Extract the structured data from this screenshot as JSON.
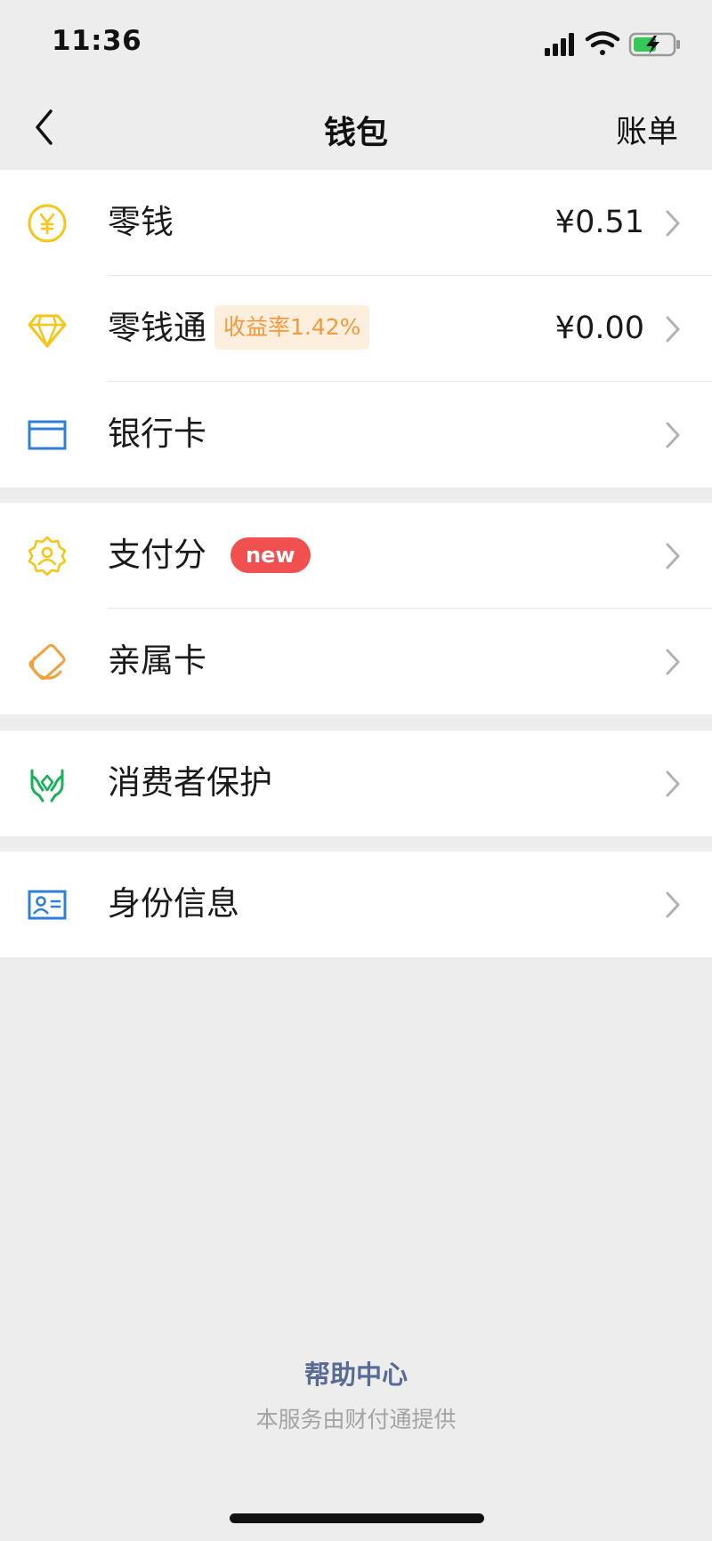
{
  "status_bar": {
    "time": "11:36",
    "battery_charging": true
  },
  "nav": {
    "back_icon": "chevron-left-icon",
    "title": "钱包",
    "bill_label": "账单"
  },
  "groups": [
    {
      "items": [
        {
          "icon": "yuan-coin-icon",
          "label": "零钱",
          "value": "¥0.51"
        },
        {
          "icon": "diamond-icon",
          "label": "零钱通",
          "badge": "收益率1.42%",
          "value": "¥0.00"
        },
        {
          "icon": "bank-card-icon",
          "label": "银行卡"
        }
      ]
    },
    {
      "items": [
        {
          "icon": "badge-user-icon",
          "label": "支付分",
          "badge": "new"
        },
        {
          "icon": "family-card-icon",
          "label": "亲属卡"
        }
      ]
    },
    {
      "items": [
        {
          "icon": "hands-protect-icon",
          "label": "消费者保护"
        }
      ]
    },
    {
      "items": [
        {
          "icon": "id-card-icon",
          "label": "身份信息"
        }
      ]
    }
  ],
  "footer": {
    "help_link": "帮助中心",
    "provider_text": "本服务由财付通提供"
  },
  "colors": {
    "background": "#ededed",
    "link_blue": "#576b95",
    "badge_orange_bg": "#fdeedd",
    "badge_orange_text": "#f29a3b",
    "badge_red": "#f05050",
    "icon_yellow": "#f5c518",
    "icon_orange": "#f0a23c",
    "icon_blue": "#2f7fd6",
    "icon_green": "#19b25b"
  }
}
